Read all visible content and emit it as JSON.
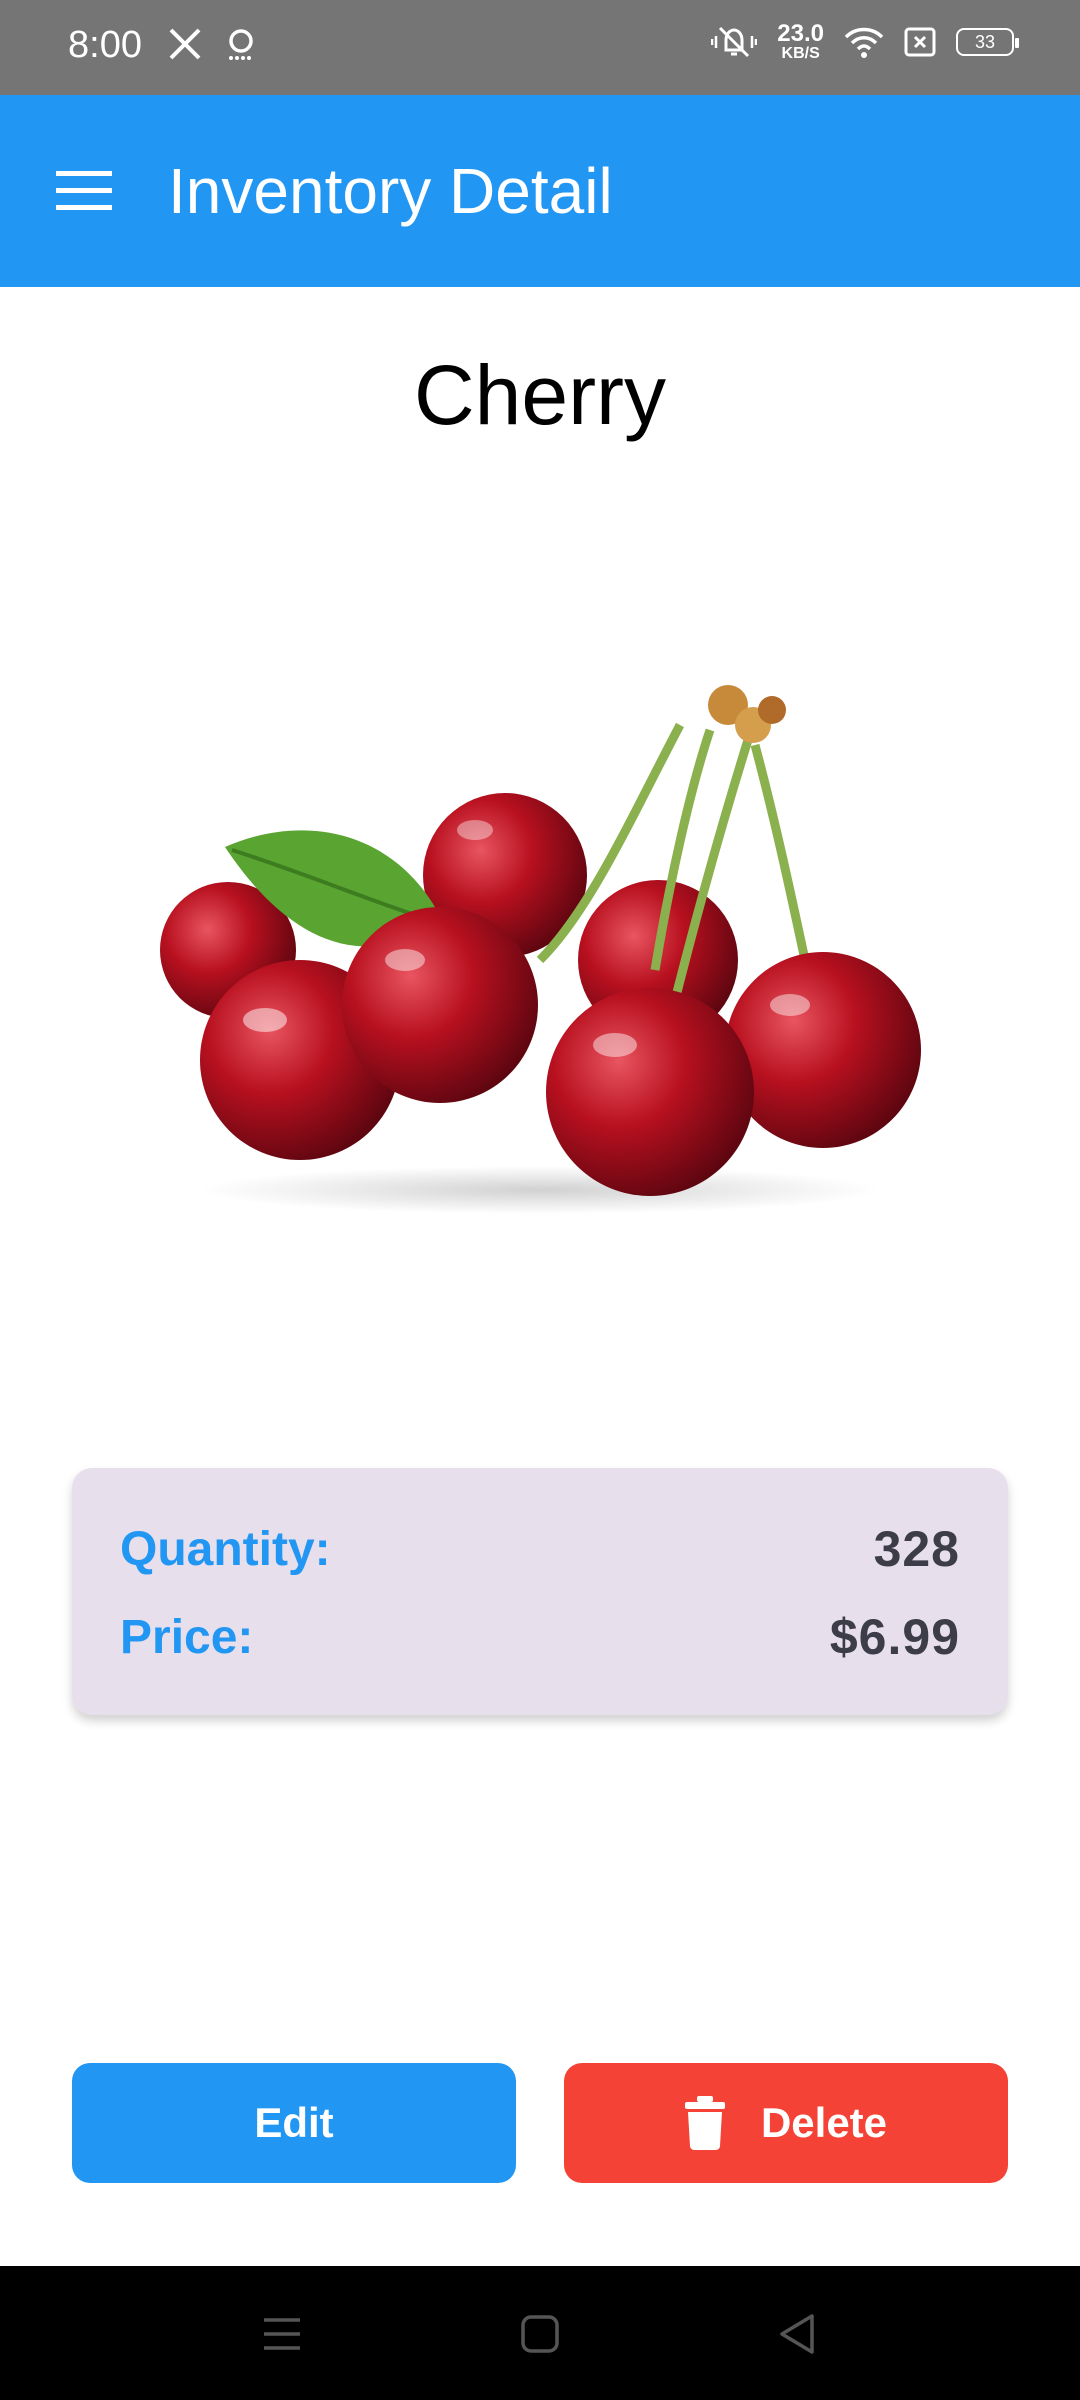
{
  "status_bar": {
    "time": "8:00",
    "left_icons": [
      "x-logo-icon",
      "assistant-icon"
    ],
    "net_speed_value": "23.0",
    "net_speed_unit": "KB/S",
    "battery": "33",
    "right_icons": [
      "vibrate-mute-icon",
      "wifi-icon",
      "sim-off-icon",
      "battery-icon"
    ]
  },
  "app_bar": {
    "title": "Inventory Detail",
    "menu_icon": "hamburger-menu-icon",
    "color": "#2196F3"
  },
  "item": {
    "name": "Cherry",
    "image": "cherries-image",
    "quantity_label": "Quantity:",
    "quantity_value": "328",
    "price_label": "Price:",
    "price_value": "$6.99"
  },
  "actions": {
    "edit_label": "Edit",
    "delete_label": "Delete",
    "edit_color": "#2196F3",
    "delete_color": "#F44336"
  },
  "nav_bar": {
    "icons": [
      "recents-icon",
      "home-icon",
      "back-icon"
    ]
  }
}
